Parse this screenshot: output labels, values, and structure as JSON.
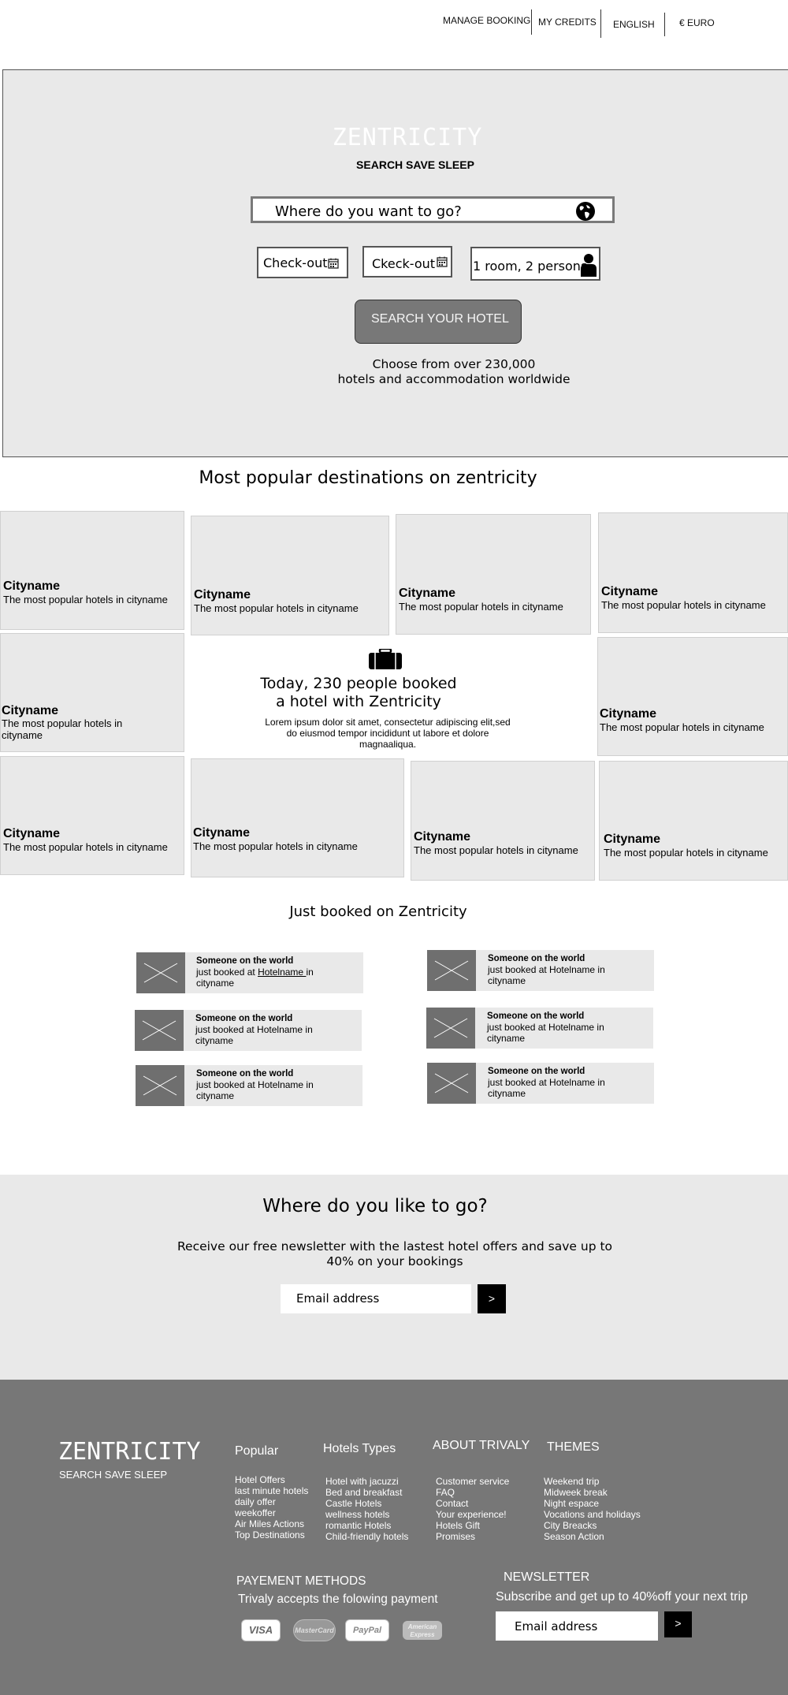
{
  "nav": {
    "manage_booking": "MANAGE BOOKING",
    "my_credits": "MY CREDITS",
    "language": "ENGLISH",
    "currency": "€ EURO"
  },
  "hero": {
    "brand": "ZENTRICITY",
    "tagline": "SEARCH SAVE SLEEP",
    "search_placeholder": "Where do you want to go?",
    "checkin_label": "Check-out",
    "checkout_label": "Ckeck-out",
    "guests_label": "1 room, 2 persons",
    "search_button": "SEARCH YOUR HOTEL",
    "sub_line1": "Choose from over 230,000",
    "sub_line2": "hotels and accommodation worldwide"
  },
  "destinations": {
    "title": "Most popular destinations on zentricity",
    "city": "Cityname",
    "desc": "The most popular hotels in cityname",
    "desc_line1": "The most popular hotels in",
    "desc_line2": "cityname",
    "center": {
      "headline1": "Today, 230 people booked",
      "headline2": "a hotel with Zentricity",
      "body1": "Lorem ipsum dolor sit amet, consectetur adipiscing elit,sed",
      "body2": "do eiusmod tempor incididunt ut labore et dolore",
      "body3": "magnaaliqua."
    }
  },
  "just_booked": {
    "title": "Just booked on Zentricity",
    "who": "Someone on the world",
    "what": "just booked at Hotelname in cityname",
    "what_prefix": "just booked at ",
    "what_link": "Hotelname ",
    "what_suffix": "in cityname"
  },
  "newsletter": {
    "title": "Where do you like to go?",
    "line1": "Receive our free newsletter with the lastest hotel offers and save up to",
    "line2": "40% on your bookings",
    "email_placeholder": "Email address",
    "submit": ">"
  },
  "footer": {
    "brand": "ZENTRICITY",
    "tagline": "SEARCH SAVE SLEEP",
    "popular": {
      "title": "Popular",
      "items": [
        "Hotel Offers",
        "last minute hotels",
        "daily offer",
        "weekoffer",
        "Air Miles Actions",
        "Top Destinations"
      ]
    },
    "hotel_types": {
      "title": "Hotels Types",
      "items": [
        "Hotel with jacuzzi",
        "Bed and breakfast",
        "Castle Hotels",
        "wellness hotels",
        "romantic Hotels",
        "Child-friendly hotels"
      ]
    },
    "about": {
      "title": "ABOUT TRIVALY",
      "items": [
        "Customer service",
        "FAQ",
        "Contact",
        "Your experience!",
        "Hotels Gift",
        "Promises"
      ]
    },
    "themes": {
      "title": "THEMES",
      "items": [
        "Weekend trip",
        "Midweek break",
        "Night espace",
        "Vocations and holidays",
        "City Breacks",
        "Season Action"
      ]
    },
    "payment": {
      "title": "PAYEMENT METHODS",
      "subtitle": "Trivaly accepts the folowing payment",
      "methods": [
        "VISA",
        "MasterCard",
        "PayPal",
        "American Express"
      ]
    },
    "newsletter": {
      "title": "NEWSLETTER",
      "subtitle": "Subscribe and get up to 40%off your next trip",
      "email_placeholder": "Email address",
      "submit": ">"
    }
  }
}
